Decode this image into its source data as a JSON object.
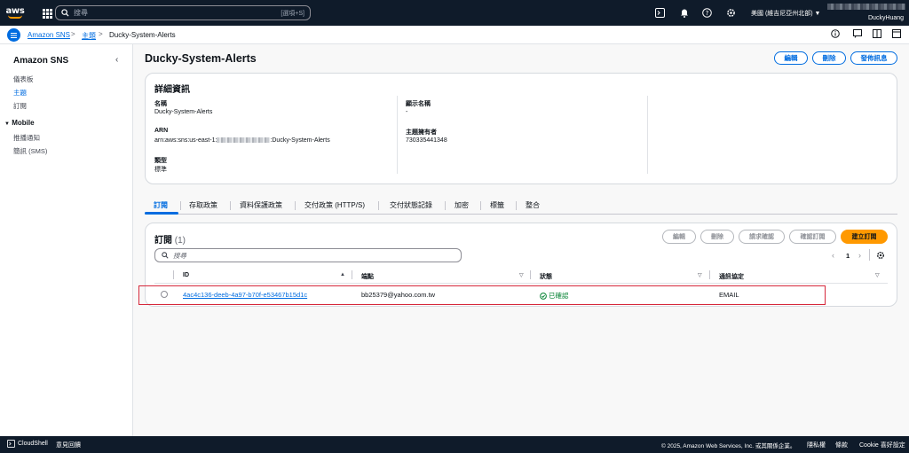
{
  "topnav": {
    "logo_text": "aws",
    "search_placeholder": "搜尋",
    "search_shortcut": "[選項+S]",
    "region": "美國 (維吉尼亞州北部) ▼",
    "username": "DuckyHuang"
  },
  "breadcrumb": {
    "items": [
      "Amazon SNS",
      "主題",
      "Ducky-System-Alerts"
    ]
  },
  "sidenav": {
    "title": "Amazon SNS",
    "items": [
      "儀表板",
      "主題",
      "訂閱"
    ],
    "section": "Mobile",
    "section_items": [
      "推播通知",
      "簡訊 (SMS)"
    ]
  },
  "page": {
    "title": "Ducky-System-Alerts",
    "actions": [
      "編輯",
      "刪除",
      "發佈訊息"
    ]
  },
  "details": {
    "heading": "詳細資訊",
    "name_label": "名稱",
    "name_value": "Ducky-System-Alerts",
    "arn_label": "ARN",
    "arn_prefix": "arn:aws:sns:us-east-1:",
    "arn_suffix": ":Ducky-System-Alerts",
    "type_label": "類型",
    "type_value": "標準",
    "display_label": "顯示名稱",
    "display_value": "-",
    "owner_label": "主題擁有者",
    "owner_value": "730335441348"
  },
  "tabs": [
    "訂閱",
    "存取政策",
    "資料保護政策",
    "交付政策 (HTTP/S)",
    "交付狀態記錄",
    "加密",
    "標籤",
    "整合"
  ],
  "subscriptions": {
    "title": "訂閱",
    "count": "(1)",
    "buttons": [
      "編輯",
      "刪除",
      "請求確認",
      "確認訂閱",
      "建立訂閱"
    ],
    "search_placeholder": "搜尋",
    "page": "1",
    "columns": [
      "ID",
      "端點",
      "狀態",
      "通訊協定"
    ],
    "rows": [
      {
        "id": "4ac4c136-deeb-4a97-b70f-e53467b15d1c",
        "endpoint": "bb25379@yahoo.com.tw",
        "status": "已確認",
        "protocol": "EMAIL"
      }
    ]
  },
  "footer": {
    "cloudshell": "CloudShell",
    "feedback": "意見回饋",
    "copyright": "© 2025, Amazon Web Services, Inc. 或其關係企業。",
    "privacy": "隱私權",
    "terms": "條款",
    "cookie": "Cookie 喜好設定"
  },
  "colors": {
    "accent": "#006ce0",
    "primary_button": "#ff9900",
    "nav_bg": "#0f1b2a",
    "success": "#00802f",
    "highlight": "#d6283b"
  }
}
